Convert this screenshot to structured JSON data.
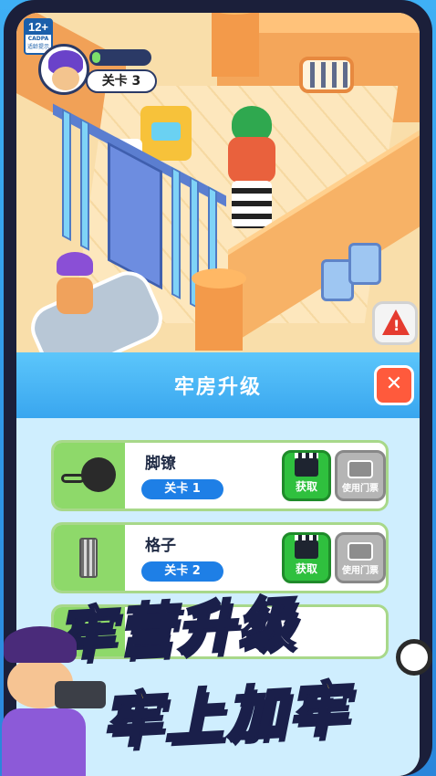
{
  "age_rating": {
    "age": "12+",
    "org": "CADPA",
    "tip": "适龄提示"
  },
  "hud": {
    "level_label": "关卡 3",
    "progress": 0.15
  },
  "panel": {
    "title": "牢房升级",
    "close_label": "✕",
    "items": [
      {
        "name": "脚镣",
        "level": "关卡 1",
        "get_label": "获取",
        "ticket_label": "使用门票"
      },
      {
        "name": "格子",
        "level": "关卡 2",
        "get_label": "获取",
        "ticket_label": "使用门票"
      }
    ]
  },
  "promo": {
    "line1": "牢营升级",
    "line2": "牢上加牢"
  },
  "colors": {
    "header_blue": "#39a6ef",
    "close_red": "#ff5a3c",
    "get_green": "#2fc03e",
    "level_pill": "#1e7fe6",
    "promo_yellow": "#ffd53a"
  }
}
